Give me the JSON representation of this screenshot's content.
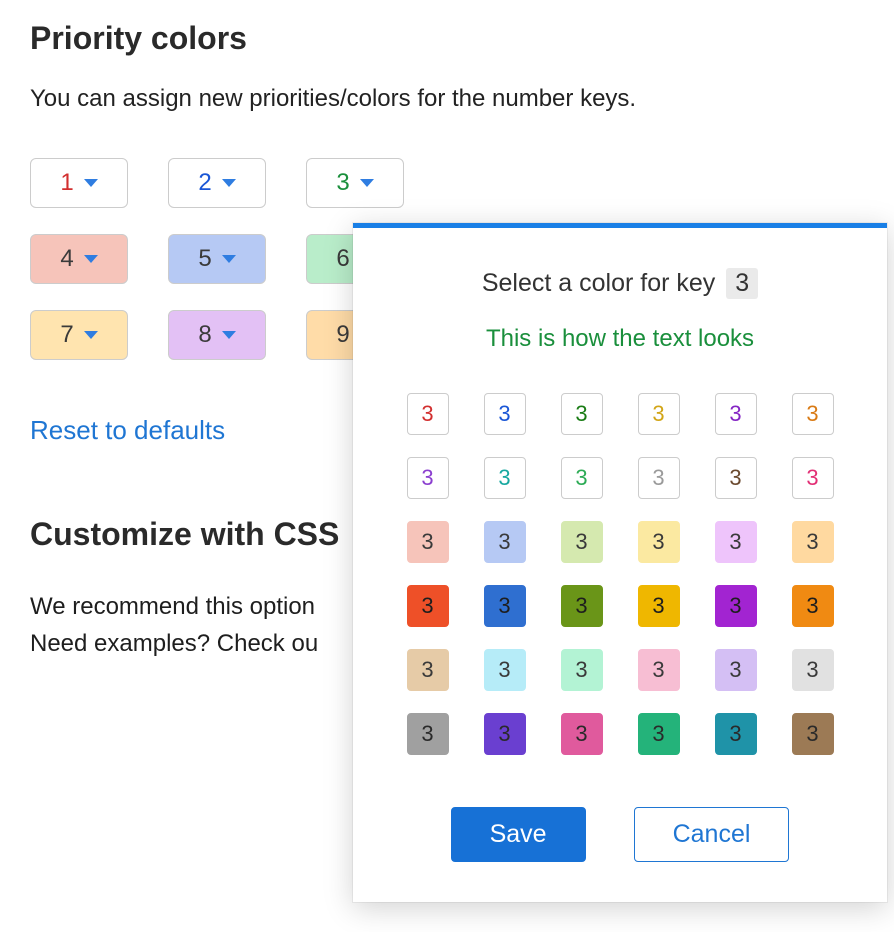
{
  "section": {
    "title": "Priority colors",
    "desc": "You can assign new priorities/colors for the number keys.",
    "reset_label": "Reset to defaults"
  },
  "keys": [
    {
      "num": "1",
      "text_color": "#d22f2f",
      "bg": "#ffffff"
    },
    {
      "num": "2",
      "text_color": "#1a56d6",
      "bg": "#ffffff"
    },
    {
      "num": "3",
      "text_color": "#1a8f3c",
      "bg": "#ffffff"
    },
    {
      "num": "4",
      "text_color": "#3a3a3a",
      "bg": "#f6c4ba"
    },
    {
      "num": "5",
      "text_color": "#3a3a3a",
      "bg": "#b6c9f4"
    },
    {
      "num": "6",
      "text_color": "#3a3a3a",
      "bg": "#b9edca"
    },
    {
      "num": "7",
      "text_color": "#3a3a3a",
      "bg": "#ffe4af"
    },
    {
      "num": "8",
      "text_color": "#3a3a3a",
      "bg": "#e3c1f5"
    },
    {
      "num": "9",
      "text_color": "#3a3a3a",
      "bg": "#ffdca8"
    }
  ],
  "css_section": {
    "title": "Customize with CSS",
    "desc_line1": "We recommend this option",
    "desc_line2": "Need examples? Check ou"
  },
  "modal": {
    "header_prefix": "Select a color for key",
    "key": "3",
    "preview_text": "This is how the text looks",
    "preview_color": "#1a8f3c",
    "save_label": "Save",
    "cancel_label": "Cancel",
    "sample_digit": "3",
    "swatches": [
      {
        "bg": "#ffffff",
        "fg": "#d22f2f"
      },
      {
        "bg": "#ffffff",
        "fg": "#1a56d6"
      },
      {
        "bg": "#ffffff",
        "fg": "#1a7c15"
      },
      {
        "bg": "#ffffff",
        "fg": "#d2a516"
      },
      {
        "bg": "#ffffff",
        "fg": "#8425c4"
      },
      {
        "bg": "#ffffff",
        "fg": "#d97a14"
      },
      {
        "bg": "#ffffff",
        "fg": "#8b3fcf"
      },
      {
        "bg": "#ffffff",
        "fg": "#17a8a0"
      },
      {
        "bg": "#ffffff",
        "fg": "#2cab55"
      },
      {
        "bg": "#ffffff",
        "fg": "#9a9a9a"
      },
      {
        "bg": "#ffffff",
        "fg": "#6b4a2f"
      },
      {
        "bg": "#ffffff",
        "fg": "#e22f75"
      },
      {
        "bg": "#f6c4ba",
        "fg": "#3a3a3a"
      },
      {
        "bg": "#b6c9f4",
        "fg": "#3a3a3a"
      },
      {
        "bg": "#d5e9af",
        "fg": "#3a3a3a"
      },
      {
        "bg": "#fbe9a1",
        "fg": "#3a3a3a"
      },
      {
        "bg": "#eec4fb",
        "fg": "#3a3a3a"
      },
      {
        "bg": "#ffd9a0",
        "fg": "#3a3a3a"
      },
      {
        "bg": "#ee5028",
        "fg": "#1e1e1e"
      },
      {
        "bg": "#2f6fd0",
        "fg": "#1e1e1e"
      },
      {
        "bg": "#6a9518",
        "fg": "#1e1e1e"
      },
      {
        "bg": "#efb700",
        "fg": "#1e1e1e"
      },
      {
        "bg": "#a224d1",
        "fg": "#1e1e1e"
      },
      {
        "bg": "#f08a12",
        "fg": "#1e1e1e"
      },
      {
        "bg": "#e6cba7",
        "fg": "#3a3a3a"
      },
      {
        "bg": "#b6ecf8",
        "fg": "#3a3a3a"
      },
      {
        "bg": "#b3f3d4",
        "fg": "#3a3a3a"
      },
      {
        "bg": "#f7bed3",
        "fg": "#3a3a3a"
      },
      {
        "bg": "#d4bff4",
        "fg": "#3a3a3a"
      },
      {
        "bg": "#e1e1e1",
        "fg": "#3a3a3a"
      },
      {
        "bg": "#a0a0a0",
        "fg": "#2a2a2a"
      },
      {
        "bg": "#6a3fd0",
        "fg": "#2a2a2a"
      },
      {
        "bg": "#e05a9d",
        "fg": "#2a2a2a"
      },
      {
        "bg": "#24b37a",
        "fg": "#2a2a2a"
      },
      {
        "bg": "#1f93a8",
        "fg": "#2a2a2a"
      },
      {
        "bg": "#9c7a55",
        "fg": "#2a2a2a"
      }
    ]
  }
}
